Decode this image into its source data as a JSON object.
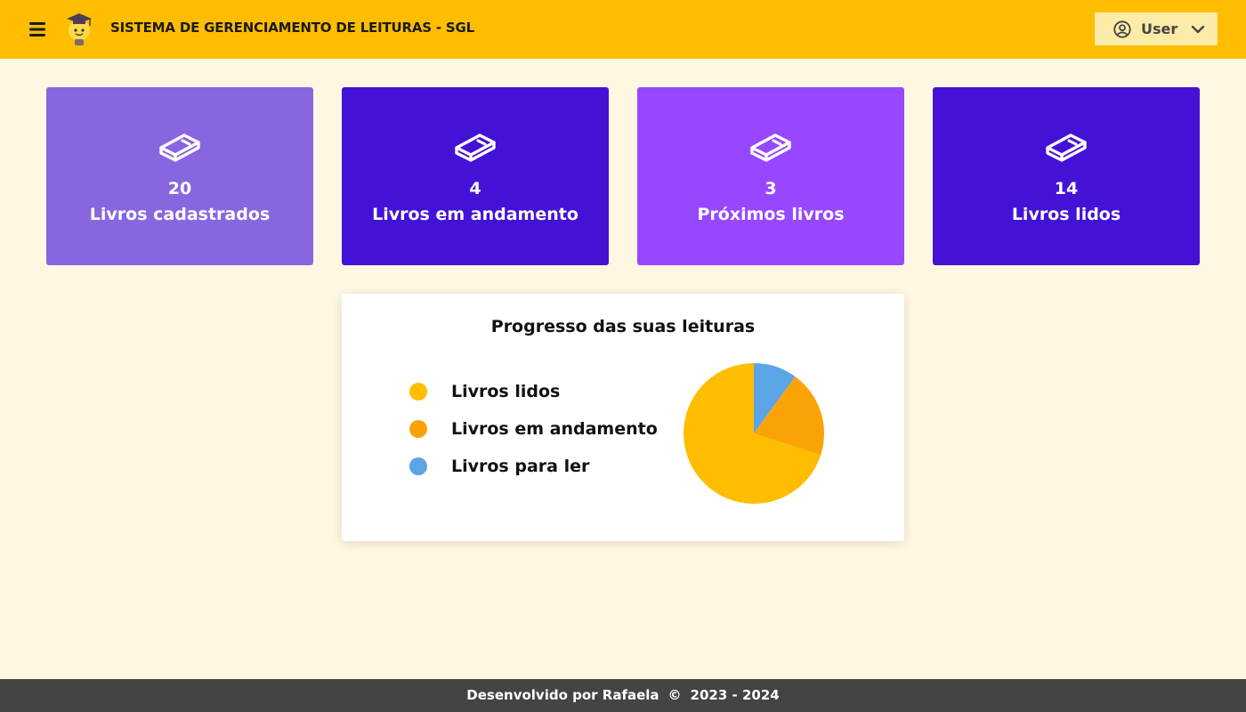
{
  "header": {
    "title": "SISTEMA DE GERENCIAMENTO DE LEITURAS - SGL",
    "user_label": "User",
    "bg_color": "#FFBD00"
  },
  "cards": [
    {
      "count": "20",
      "label": "Livros cadastrados",
      "color": "#8866E0",
      "icon": "book-icon"
    },
    {
      "count": "4",
      "label": "Livros em andamento",
      "color": "#4412D6",
      "icon": "book-icon"
    },
    {
      "count": "3",
      "label": "Próximos livros",
      "color": "#9747FF",
      "icon": "book-icon"
    },
    {
      "count": "14",
      "label": "Livros lidos",
      "color": "#4412D6",
      "icon": "book-icon"
    }
  ],
  "chart_data": {
    "type": "pie",
    "title": "Progresso das suas leituras",
    "categories": [
      "Livros lidos",
      "Livros em andamento",
      "Livros para ler"
    ],
    "values": [
      14,
      4,
      2
    ],
    "colors": [
      "#FFBD00",
      "#FAA307",
      "#5BA4E6"
    ],
    "legend": "left"
  },
  "footer": {
    "author": "Desenvolvido por Rafaela",
    "copyright_symbol": "©",
    "years": "2023 - 2024"
  }
}
